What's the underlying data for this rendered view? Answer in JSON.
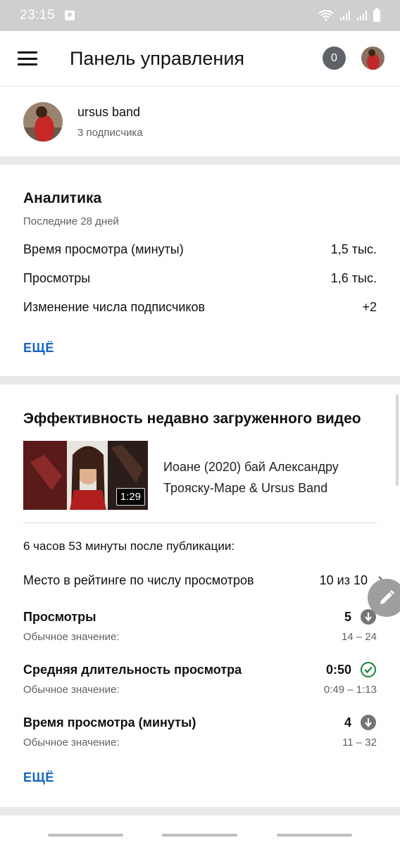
{
  "status_bar": {
    "time": "23:15"
  },
  "app_bar": {
    "title": "Панель управления",
    "notification_count": "0"
  },
  "channel": {
    "name": "ursus band",
    "subscribers": "3 подписчика"
  },
  "analytics": {
    "title": "Аналитика",
    "period": "Последние 28 дней",
    "rows": [
      {
        "label": "Время просмотра (минуты)",
        "value": "1,5 тыс."
      },
      {
        "label": "Просмотры",
        "value": "1,6 тыс."
      },
      {
        "label": "Изменение числа подписчиков",
        "value": "+2"
      }
    ],
    "more_label": "ЕЩЁ"
  },
  "recent_video": {
    "section_title": "Эффективность недавно загруженного видео",
    "duration": "1:29",
    "title": "Иоане (2020) бай Александру Трояску-Маре &  Ursus Band",
    "since_published": "6 часов 53 минуты после публикации:",
    "rank": {
      "label": "Место в рейтинге по числу просмотров",
      "value": "10 из 10"
    },
    "stats": [
      {
        "label": "Просмотры",
        "value": "5",
        "typical_label": "Обычное значение:",
        "typical_range": "14 – 24",
        "status_icon": "arrow-down-circle-icon"
      },
      {
        "label": "Средняя длительность просмотра",
        "value": "0:50",
        "typical_label": "Обычное значение:",
        "typical_range": "0:49 – 1:13",
        "status_icon": "check-circle-icon"
      },
      {
        "label": "Время просмотра (минуты)",
        "value": "4",
        "typical_label": "Обычное значение:",
        "typical_range": "11 – 32",
        "status_icon": "arrow-down-circle-icon"
      }
    ],
    "more_label": "ЕЩЁ"
  },
  "colors": {
    "link": "#1565c0",
    "success": "#188038",
    "neutral_icon": "#757575",
    "badge": "#5f6368"
  }
}
